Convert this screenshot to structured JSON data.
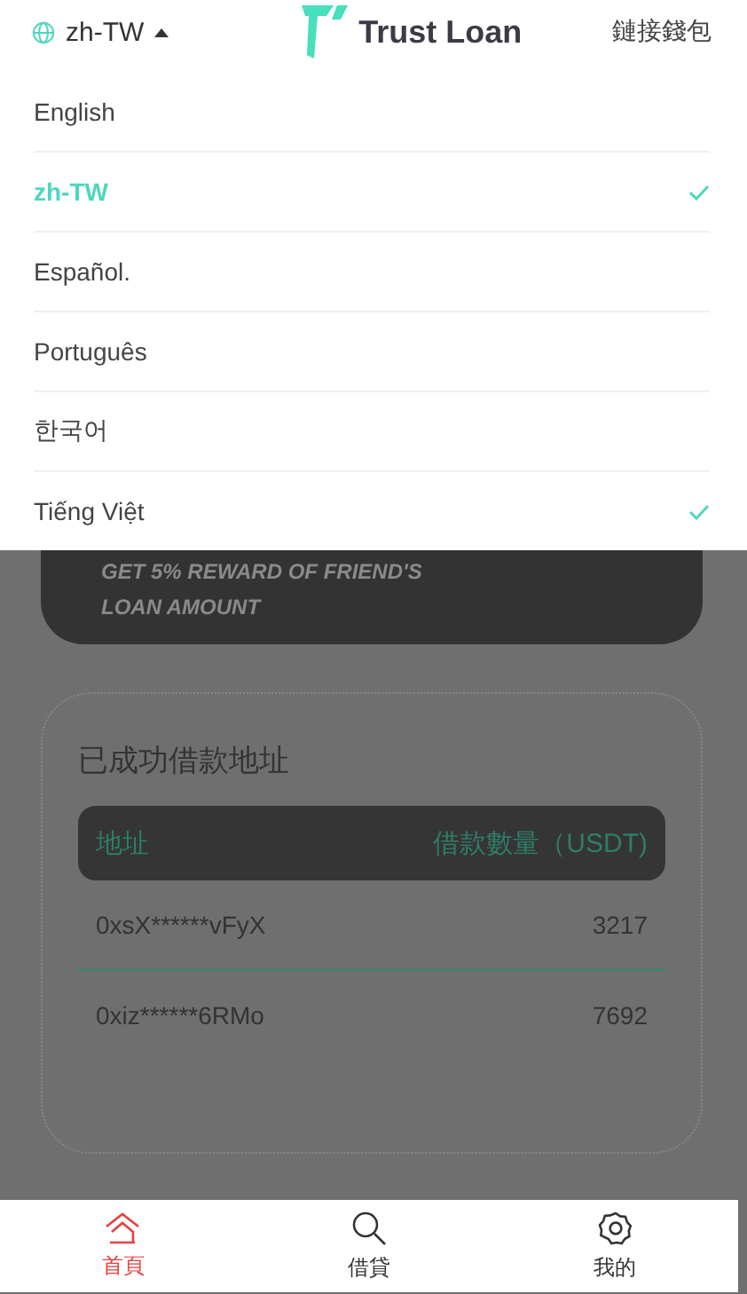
{
  "header": {
    "language": "zh-TW",
    "logo_text": "Trust Loan",
    "connect_wallet": "鏈接錢包"
  },
  "language_menu": [
    {
      "label": "English",
      "selected": false,
      "checked": false
    },
    {
      "label": "zh-TW",
      "selected": true,
      "checked": true
    },
    {
      "label": "Español.",
      "selected": false,
      "checked": false
    },
    {
      "label": "Português",
      "selected": false,
      "checked": false
    },
    {
      "label": "한국어",
      "selected": false,
      "checked": false
    },
    {
      "label": "Tiếng Việt",
      "selected": false,
      "checked": true
    }
  ],
  "banner": {
    "lines": [
      "GET 5% REWARD OF FRIEND'S",
      "LOAN AMOUNT"
    ]
  },
  "loans": {
    "title": "已成功借款地址",
    "columns": [
      "地址",
      "借款數量（USDT)"
    ],
    "rows": [
      {
        "address": "0xsX******vFyX",
        "amount": "3217"
      },
      {
        "address": "0xiz******6RMo",
        "amount": "7692"
      }
    ]
  },
  "tab_bar": [
    {
      "label": "首頁",
      "selected": true
    },
    {
      "label": "借貸",
      "selected": false
    },
    {
      "label": "我的",
      "selected": false
    }
  ]
}
